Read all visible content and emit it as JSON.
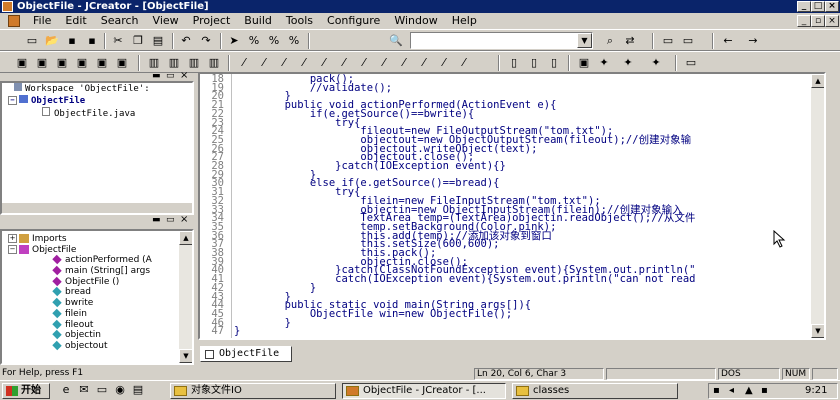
{
  "window": {
    "title": "ObjectFile - JCreator - [ObjectFile]"
  },
  "menu": [
    "File",
    "Edit",
    "Search",
    "View",
    "Project",
    "Build",
    "Tools",
    "Configure",
    "Window",
    "Help"
  ],
  "workspace": {
    "line1": "Workspace 'ObjectFile':",
    "project": "ObjectFile",
    "file": "ObjectFile.java"
  },
  "classview": {
    "items": [
      "Imports",
      "ObjectFile",
      "actionPerformed (A",
      "main (String[] args",
      "ObjectFile ()",
      "bread",
      "bwrite",
      "filein",
      "fileout",
      "objectin",
      "objectout"
    ]
  },
  "editor": {
    "tab": "ObjectFile",
    "lines": [
      {
        "n": "18",
        "t": "            pack();"
      },
      {
        "n": "19",
        "t": "            //validate();"
      },
      {
        "n": "20",
        "t": "        }"
      },
      {
        "n": "21",
        "t": "        public void actionPerformed(ActionEvent e){"
      },
      {
        "n": "22",
        "t": "            if(e.getSource()==bwrite){"
      },
      {
        "n": "23",
        "t": "                try{"
      },
      {
        "n": "24",
        "t": "                    fileout=new FileOutputStream(\"tom.txt\");"
      },
      {
        "n": "25",
        "t": "                    objectout=new ObjectOutputStream(fileout);//创建对象输"
      },
      {
        "n": "26",
        "t": "                    objectout.writeObject(text);"
      },
      {
        "n": "27",
        "t": "                    objectout.close();"
      },
      {
        "n": "28",
        "t": "                }catch(IOException event){}"
      },
      {
        "n": "29",
        "t": "            }"
      },
      {
        "n": "30",
        "t": "            else if(e.getSource()==bread){"
      },
      {
        "n": "31",
        "t": "                try{"
      },
      {
        "n": "32",
        "t": "                    filein=new FileInputStream(\"tom.txt\");"
      },
      {
        "n": "33",
        "t": "                    objectin=new ObjectInputStream(filein);//创建对象输入"
      },
      {
        "n": "34",
        "t": "                    TextArea temp=(TextArea)objectin.readObject();//从文件"
      },
      {
        "n": "35",
        "t": "                    temp.setBackground(Color.pink);"
      },
      {
        "n": "36",
        "t": "                    this.add(temp);//添加该对象到窗口"
      },
      {
        "n": "37",
        "t": "                    this.setSize(600,600);"
      },
      {
        "n": "38",
        "t": "                    this.pack();"
      },
      {
        "n": "39",
        "t": "                    objectin.close();"
      },
      {
        "n": "40",
        "t": "                }catch(ClassNotFoundException event){System.out.println(\""
      },
      {
        "n": "41",
        "t": "                catch(IOException event){System.out.println(\"can not read"
      },
      {
        "n": "42",
        "t": "            }"
      },
      {
        "n": "43",
        "t": "        }"
      },
      {
        "n": "44",
        "t": "        public static void main(String args[]){"
      },
      {
        "n": "45",
        "t": "            ObjectFile win=new ObjectFile();"
      },
      {
        "n": "46",
        "t": "        }"
      },
      {
        "n": "47",
        "t": "}"
      }
    ]
  },
  "status": {
    "help": "For Help, press F1",
    "pos": "Ln 20, Col 6, Char 3",
    "dos": "DOS",
    "num": "NUM"
  },
  "taskbar": {
    "start": "开始",
    "tasks": [
      "对象文件IO",
      "ObjectFile - JCreator - [...",
      "classes"
    ],
    "time": "9:21"
  }
}
